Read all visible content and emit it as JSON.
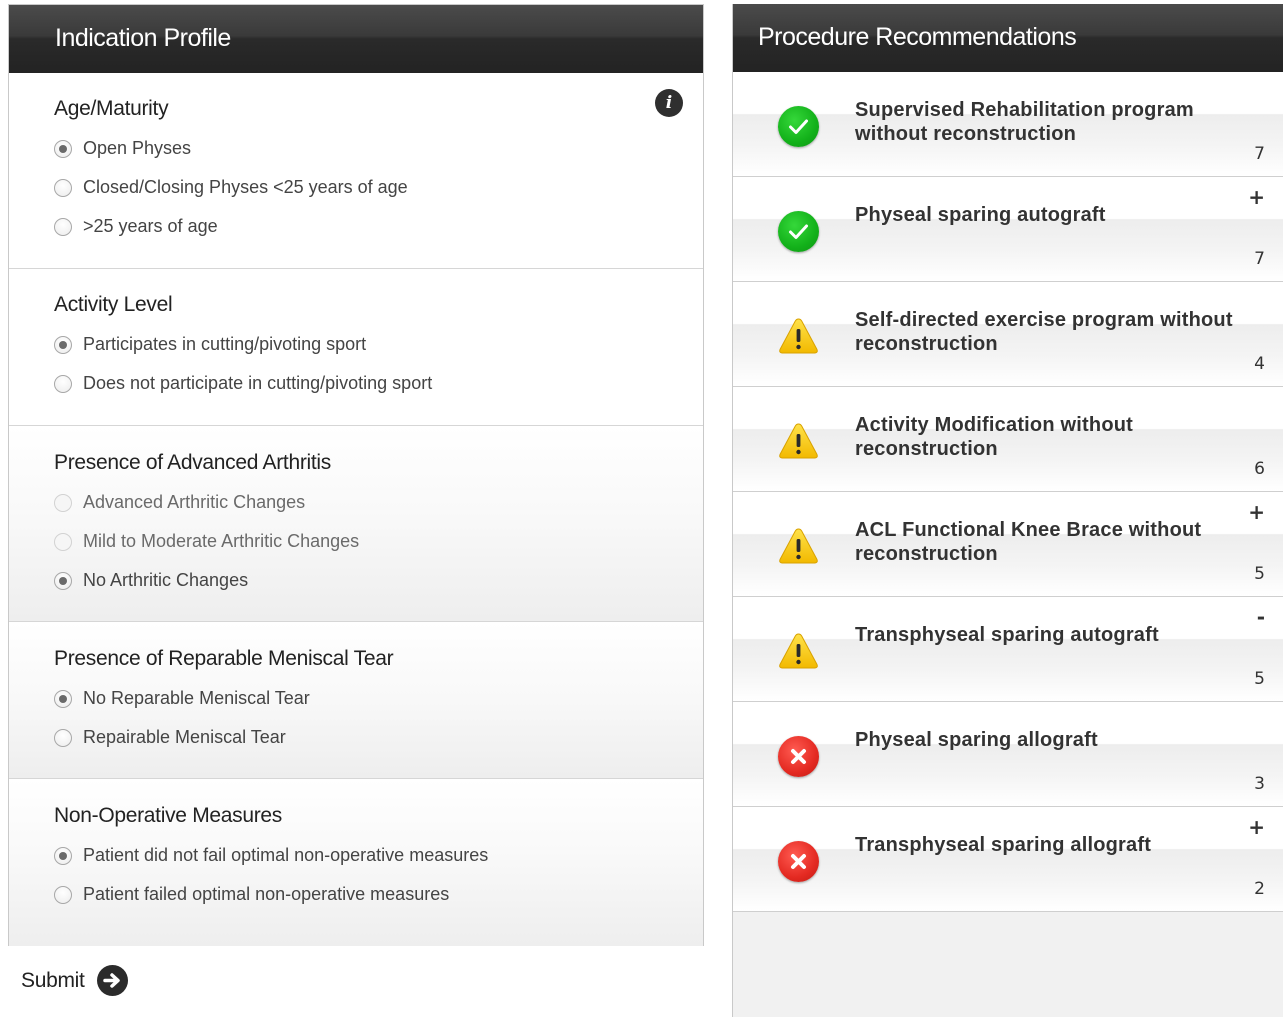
{
  "indication_profile": {
    "title": "Indication Profile",
    "info_icon": "i",
    "sections": [
      {
        "title": "Age/Maturity",
        "options": [
          {
            "label": "Open Physes",
            "selected": true,
            "disabled": false
          },
          {
            "label": "Closed/Closing Physes <25 years of age",
            "selected": false,
            "disabled": false
          },
          {
            "label": ">25 years of age",
            "selected": false,
            "disabled": false
          }
        ]
      },
      {
        "title": "Activity Level",
        "options": [
          {
            "label": "Participates in cutting/pivoting sport",
            "selected": true,
            "disabled": false
          },
          {
            "label": "Does not participate in cutting/pivoting sport",
            "selected": false,
            "disabled": false
          }
        ]
      },
      {
        "title": "Presence of Advanced Arthritis",
        "options": [
          {
            "label": "Advanced Arthritic Changes",
            "selected": false,
            "disabled": true
          },
          {
            "label": "Mild to Moderate Arthritic Changes",
            "selected": false,
            "disabled": true
          },
          {
            "label": "No Arthritic Changes",
            "selected": true,
            "disabled": false
          }
        ]
      },
      {
        "title": "Presence of Reparable Meniscal Tear",
        "options": [
          {
            "label": "No Reparable Meniscal Tear",
            "selected": true,
            "disabled": false
          },
          {
            "label": "Repairable Meniscal Tear",
            "selected": false,
            "disabled": false
          }
        ]
      },
      {
        "title": "Non-Operative Measures",
        "options": [
          {
            "label": "Patient did not fail optimal non-operative measures",
            "selected": true,
            "disabled": false
          },
          {
            "label": "Patient failed optimal non-operative measures",
            "selected": false,
            "disabled": false
          }
        ]
      }
    ],
    "submit_label": "Submit"
  },
  "procedure_recommendations": {
    "title": "Procedure Recommendations",
    "items": [
      {
        "name": "Supervised Rehabilitation program without reconstruction",
        "score": "7",
        "marker": "",
        "status": "appropriate",
        "icon": "check-circle-icon"
      },
      {
        "name": "Physeal sparing autograft",
        "score": "7",
        "marker": "+",
        "status": "appropriate",
        "icon": "check-circle-icon"
      },
      {
        "name": "Self-directed exercise program without reconstruction",
        "score": "4",
        "marker": "",
        "status": "may-be-appropriate",
        "icon": "warning-triangle-icon"
      },
      {
        "name": "Activity Modification without reconstruction",
        "score": "6",
        "marker": "",
        "status": "may-be-appropriate",
        "icon": "warning-triangle-icon"
      },
      {
        "name": "ACL Functional Knee Brace without reconstruction",
        "score": "5",
        "marker": "+",
        "status": "may-be-appropriate",
        "icon": "warning-triangle-icon"
      },
      {
        "name": "Transphyseal sparing autograft",
        "score": "5",
        "marker": "-",
        "status": "may-be-appropriate",
        "icon": "warning-triangle-icon"
      },
      {
        "name": "Physeal sparing allograft",
        "score": "3",
        "marker": "",
        "status": "rarely-appropriate",
        "icon": "x-circle-icon"
      },
      {
        "name": "Transphyseal sparing allograft",
        "score": "2",
        "marker": "+",
        "status": "rarely-appropriate",
        "icon": "x-circle-icon"
      }
    ]
  },
  "colors": {
    "header_bg": "#2f2f2f",
    "appropriate": "#13b11a",
    "may_be_appropriate": "#f5c400",
    "rarely_appropriate": "#e42a22"
  }
}
